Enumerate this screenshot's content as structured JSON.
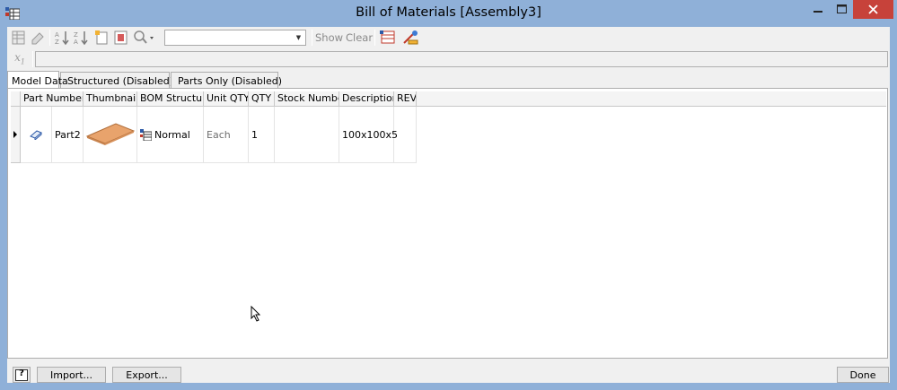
{
  "window": {
    "title": "Bill of Materials [Assembly3]",
    "app_icon": "bom-app-icon",
    "controls": [
      "minimize-icon",
      "maximize-icon",
      "close-icon"
    ]
  },
  "toolbar": {
    "icons": [
      "view-options-icon",
      "rename-icon",
      "sort-ascending-icon",
      "sort-descending-icon",
      "new-item-icon",
      "choose-columns-icon",
      "find-icon",
      "export-icon",
      "filter-icon"
    ],
    "filter_value": "",
    "show_label": "Show",
    "clear_label": "Clear"
  },
  "formula_bar": {
    "icon": "fx-icon",
    "fx_label": "x",
    "value": ""
  },
  "tabs": [
    {
      "label": "Model Data",
      "active": true
    },
    {
      "label": "Structured (Disabled)",
      "icon": "structured-icon"
    },
    {
      "label": "Parts Only (Disabled)",
      "icon": "parts-only-icon"
    }
  ],
  "grid": {
    "columns": [
      "Part Number",
      "Thumbnail",
      "BOM Structure",
      "Unit QTY",
      "QTY",
      "Stock Number",
      "Description",
      "REV"
    ],
    "rows": [
      {
        "part_number": "Part2",
        "part_icon": "part-icon",
        "thumbnail": "plate-thumbnail",
        "bom_structure": "Normal",
        "bom_icon": "normal-structure-icon",
        "unit_qty": "Each",
        "qty": "1",
        "stock_number": "",
        "description": "100x100x5",
        "rev": ""
      }
    ]
  },
  "footer": {
    "help_icon": "help-icon",
    "help_label": "?",
    "import_label": "Import...",
    "export_label": "Export...",
    "done_label": "Done"
  },
  "colors": {
    "title_bar": "#8fb0d8",
    "close_button": "#c7423a",
    "plate": "#e8a36c"
  }
}
